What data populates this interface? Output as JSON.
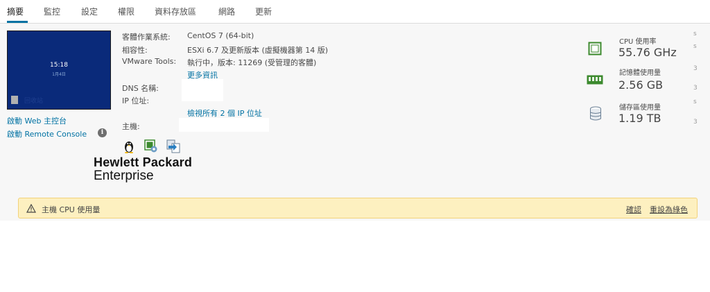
{
  "tabs": [
    {
      "label": "摘要",
      "active": true
    },
    {
      "label": "監控"
    },
    {
      "label": "設定"
    },
    {
      "label": "權限"
    },
    {
      "label": "資料存放區"
    },
    {
      "label": "網路"
    },
    {
      "label": "更新"
    }
  ],
  "console_preview": {
    "time": "15:18",
    "date": "1月4日",
    "recycle_bin": "回收站"
  },
  "console_links": {
    "web_console": "啟動 Web 主控台",
    "remote_console": "啟動 Remote Console"
  },
  "details": {
    "guest_os_label": "客體作業系統:",
    "guest_os_value": "CentOS 7 (64-bit)",
    "compat_label": "相容性:",
    "compat_value": "ESXi 6.7 及更新版本 (虛擬機器第 14 版)",
    "tools_label": "VMware Tools:",
    "tools_value": "執行中，版本: 11269 (受管理的客體)",
    "more_info": "更多資訊",
    "dns_label": "DNS 名稱:",
    "ip_label": "IP 位址:",
    "view_all_ip": "檢視所有 2 個 IP 位址",
    "host_label": "主機:"
  },
  "guest_icons": [
    "linux-penguin-icon",
    "vm-settings-gear-icon",
    "vm-migrate-icon"
  ],
  "brand": {
    "line1": "Hewlett Packard",
    "line2": "Enterprise"
  },
  "stats": [
    {
      "label": "CPU 使用率",
      "value": "55.76 GHz",
      "icon": "cpu-icon"
    },
    {
      "label": "記憶體使用量",
      "value": "2.56 GB",
      "icon": "memory-icon"
    },
    {
      "label": "儲存區使用量",
      "value": "1.19 TB",
      "icon": "storage-icon"
    }
  ],
  "alert": {
    "text": "主機 CPU 使用量",
    "acknowledge": "確認",
    "reset": "重設為綠色"
  },
  "colors": {
    "accent": "#0072a3",
    "alert_bg": "#fdf0c0",
    "alert_border": "#f2d27a",
    "stat_icon": "#3c8a2e",
    "console_bg": "#0a2a7a"
  }
}
